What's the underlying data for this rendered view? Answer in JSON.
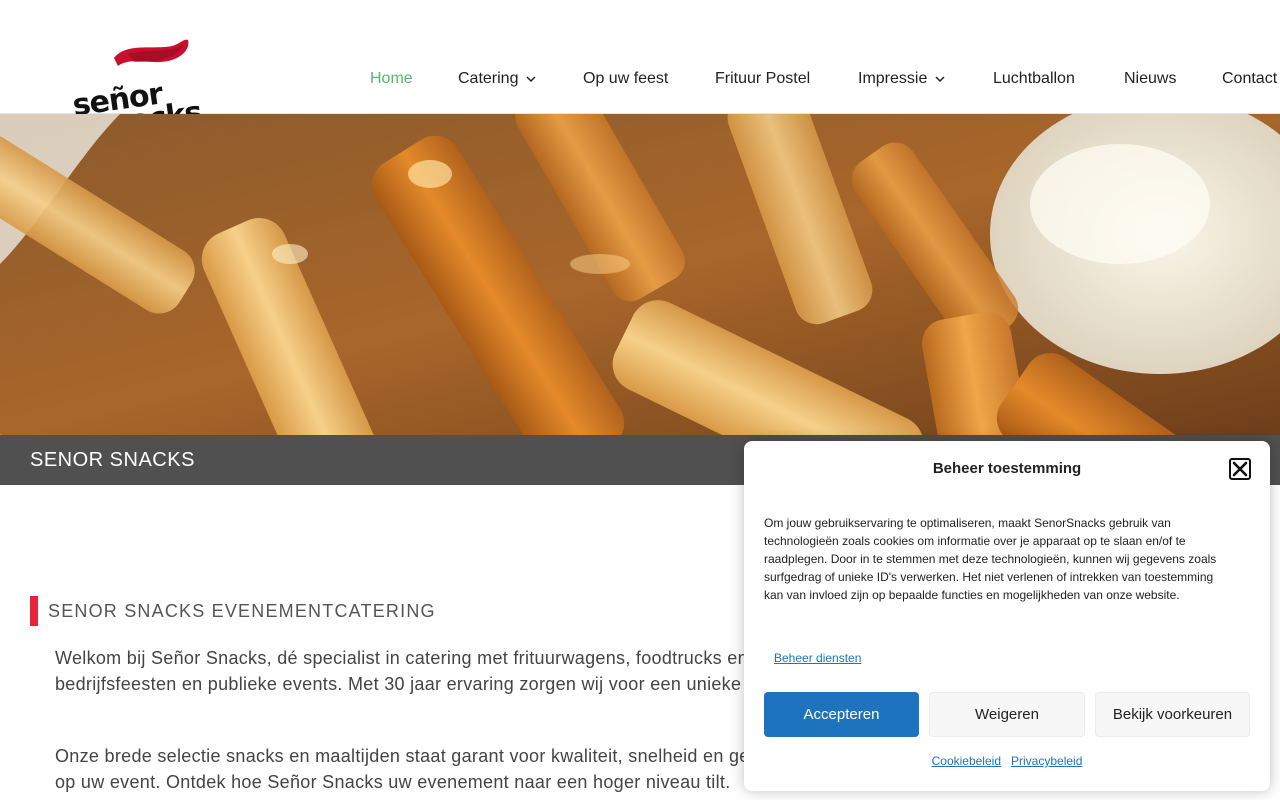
{
  "logo": {
    "alt": "Señor Snacks logo",
    "line1": "señor",
    "line2": "snacks"
  },
  "nav": {
    "items": [
      {
        "label": "Home",
        "active": true,
        "dropdown": false
      },
      {
        "label": "Catering",
        "active": false,
        "dropdown": true
      },
      {
        "label": "Op uw feest",
        "active": false,
        "dropdown": false
      },
      {
        "label": "Frituur Postel",
        "active": false,
        "dropdown": false
      },
      {
        "label": "Impressie",
        "active": false,
        "dropdown": true
      },
      {
        "label": "Luchtballon",
        "active": false,
        "dropdown": false
      },
      {
        "label": "Nieuws",
        "active": false,
        "dropdown": false
      },
      {
        "label": "Contact",
        "active": false,
        "dropdown": false
      }
    ]
  },
  "page": {
    "title": "SENOR SNACKS",
    "section_heading": "SENOR SNACKS EVENEMENTCATERING",
    "para1": "Welkom bij Señor Snacks, dé specialist in catering met frituurwagens, foodtrucks en snackkarren voor sportwedstrijden, muziekfestivals, bedrijfsfeesten en publieke events. Met 30 jaar ervaring zorgen wij voor een unieke beleving, helemaal afgestemd op uw wensen.",
    "para2": "Onze brede selectie snacks en maaltijden staat garant voor kwaliteit, snelheid en gemak. Wij nemen alles uit handen, zodat u zich kunt focussen op uw event. Ontdek hoe Señor Snacks uw evenement naar een hoger niveau tilt."
  },
  "cookie": {
    "title": "Beheer toestemming",
    "text": "Om jouw gebruikservaring te optimaliseren, maakt SenorSnacks gebruik van technologieën zoals cookies om informatie over je apparaat op te slaan en/of te raadplegen. Door in te stemmen met deze technologieën, kunnen wij gegevens zoals surfgedrag of unieke ID's verwerken. Het niet verlenen of intrekken van toestemming kan van invloed zijn op bepaalde functies en mogelijkheden van onze website.",
    "manage_label": "Beheer diensten",
    "accept_label": "Accepteren",
    "deny_label": "Weigeren",
    "prefs_label": "Bekijk voorkeuren",
    "cookie_policy_label": "Cookiebeleid",
    "privacy_policy_label": "Privacybeleid"
  },
  "colors": {
    "nav_active": "#5fb36d",
    "accent_red": "#e8243c",
    "accept_blue": "#1e73be",
    "titlebar": "#505050"
  },
  "icons": {
    "close": "close-icon",
    "chevron": "chevron-down-icon"
  }
}
